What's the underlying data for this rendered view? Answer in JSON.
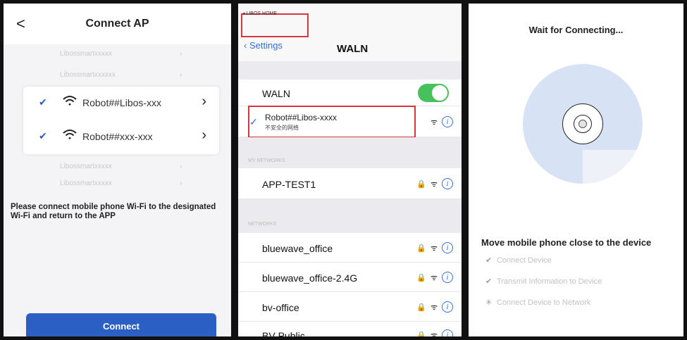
{
  "panel1": {
    "title": "Connect AP",
    "back": "<",
    "ghost_networks": [
      "Libossmartxxxxx",
      "Libossmartxxxxxx",
      "Libossmartxxxxx",
      "Libossmartxxxxx"
    ],
    "networks": [
      {
        "name": "Robot##Libos-xxx",
        "selected": true
      },
      {
        "name": "Robot##xxx-xxx",
        "selected": true
      }
    ],
    "instruction": "Please connect mobile phone Wi-Fi to the designated Wi-Fi and return to the APP",
    "connect_label": "Connect",
    "accent": "#2b5fc3"
  },
  "panel2": {
    "back_app": "◂ LIBOS HOME",
    "settings_label": "Settings",
    "title": "WALN",
    "waln_label": "WALN",
    "waln_on": true,
    "current_network": {
      "name": "Robot##Libos-xxxx",
      "subtitle": "不安全的网络"
    },
    "my_networks_label": "MY NETWORKS",
    "my_networks": [
      {
        "name": "APP-TEST1"
      }
    ],
    "networks_label": "NETWORKS",
    "networks": [
      {
        "name": "bluewave_office"
      },
      {
        "name": "bluewave_office-2.4G"
      },
      {
        "name": "bv-office"
      },
      {
        "name": "BV-Public"
      }
    ],
    "highlight_color": "#d9363e",
    "toggle_color": "#47c15c"
  },
  "panel3": {
    "title": "Wait for Connecting...",
    "instruction": "Move mobile phone close to the device",
    "steps": [
      {
        "label": "Connect Device",
        "status": "done"
      },
      {
        "label": "Transmit Information to Device",
        "status": "done"
      },
      {
        "label": "Connect Device to Network",
        "status": "in-progress"
      }
    ]
  }
}
